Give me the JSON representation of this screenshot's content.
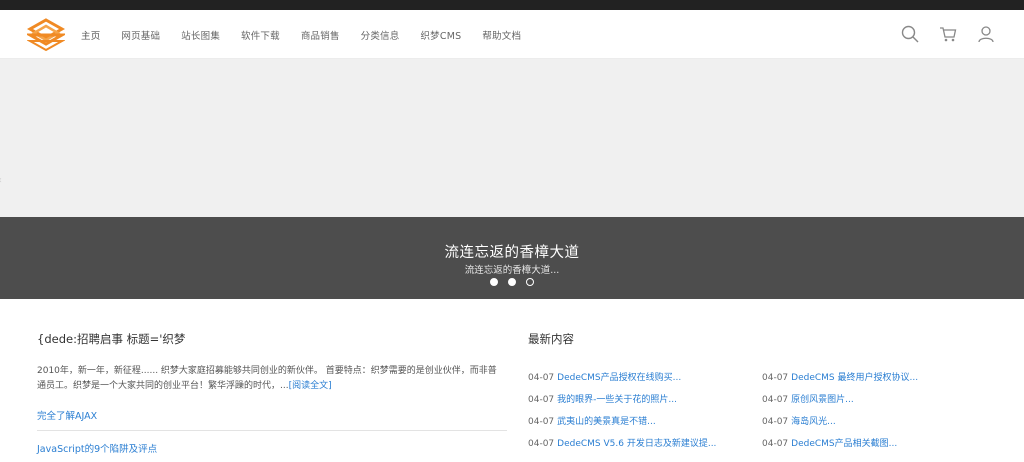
{
  "nav": {
    "items": [
      "主页",
      "网页基础",
      "站长图集",
      "软件下载",
      "商品销售",
      "分类信息",
      "织梦CMS",
      "帮助文档"
    ]
  },
  "header_icons": [
    "search-icon",
    "cart-icon",
    "user-icon"
  ],
  "banner": {
    "title": "流连忘返的香樟大道",
    "subtitle": "流连忘返的香樟大道...",
    "dots": 3,
    "active_dot": 1
  },
  "left": {
    "title": "{dede:招聘启事 标题='织梦",
    "body": "2010年，新一年，新征程...... 织梦大家庭招募能够共同创业的新伙伴。 首要特点：织梦需要的是创业伙伴，而非普通员工。织梦是一个大家共同的创业平台！繁华浮躁的时代，...",
    "read_more": "[阅读全文]",
    "links": [
      "完全了解AJAX",
      "JavaScript的9个陷阱及评点"
    ]
  },
  "right": {
    "title": "最新内容",
    "news": [
      {
        "date": "04-07",
        "title": "DedeCMS产品授权在线购买..."
      },
      {
        "date": "04-07",
        "title": "DedeCMS 最终用户授权协议..."
      },
      {
        "date": "04-07",
        "title": "我的眼界-一些关于花的照片..."
      },
      {
        "date": "04-07",
        "title": "原创风景图片..."
      },
      {
        "date": "04-07",
        "title": "武夷山的美景真是不错..."
      },
      {
        "date": "04-07",
        "title": "海岛风光..."
      },
      {
        "date": "04-07",
        "title": "DedeCMS V5.6 开发日志及新建议提..."
      },
      {
        "date": "04-07",
        "title": "DedeCMS产品相关截图..."
      }
    ]
  },
  "colors": {
    "logo_orange": "#f08a24",
    "caption_bg": "#4d4d4d",
    "link_blue": "#2a7ed2",
    "topbar": "#222222"
  }
}
